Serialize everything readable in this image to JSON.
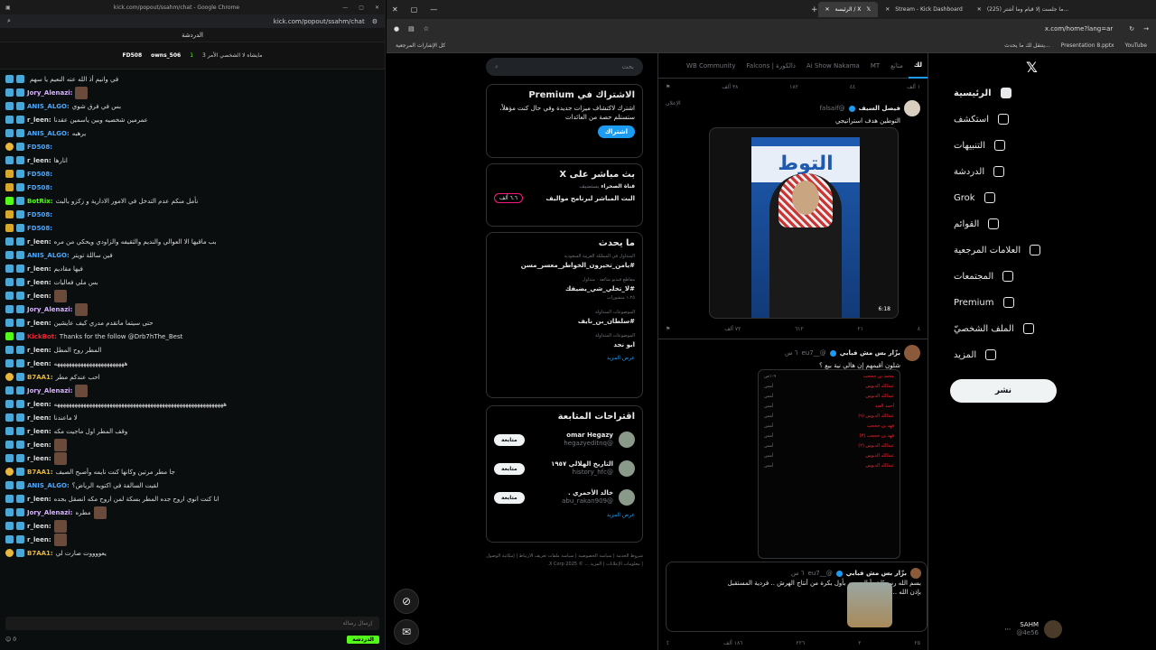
{
  "kick": {
    "title_bar": "kick.com/popout/ssahm/chat - Google Chrome",
    "url": "kick.com/popout/ssahm/chat",
    "header": "الدردشة",
    "pinned": {
      "user1": "FD508",
      "user2": "owns_506",
      "count": "1",
      "note": "مايشاه لا الشخصي الأمر 3"
    },
    "messages": [
      {
        "user": "",
        "text": "في وانيم أذ الله عنه النعيم يا سهم",
        "color": "#ddd",
        "badge": "blue"
      },
      {
        "user": "Jory_Alenazi:",
        "text": "",
        "color": "#d8b4ff",
        "badge": "blue",
        "img": true
      },
      {
        "user": "ANIS_ALGO:",
        "text": "بس في فرق شوي",
        "color": "#4aa8ff",
        "badge": "blue"
      },
      {
        "user": "r_leen:",
        "text": "عمرمين شخصيه وبين ياسمين عقدنا",
        "color": "#ddd",
        "badge": "blue"
      },
      {
        "user": "ANIS_ALGO:",
        "text": "يرهبه",
        "color": "#4aa8ff",
        "badge": "blue"
      },
      {
        "user": "FD508:",
        "text": "",
        "color": "#4aa8ff",
        "badge": "gold"
      },
      {
        "user": "r_leen:",
        "text": "انارها",
        "color": "#ddd",
        "badge": "blue"
      },
      {
        "user": "FD508:",
        "text": "",
        "color": "#4aa8ff",
        "badge": "crown"
      },
      {
        "user": "FD508:",
        "text": "",
        "color": "#4aa8ff",
        "badge": "crown"
      },
      {
        "user": "BotRix:",
        "text": "نأمل منكم عدم التدخل في الامور الادارية و زكزو بالبث",
        "color": "#53fc18",
        "badge": "green"
      },
      {
        "user": "FD508:",
        "text": "",
        "color": "#4aa8ff",
        "badge": "crown"
      },
      {
        "user": "FD508:",
        "text": "",
        "color": "#4aa8ff",
        "badge": "crown"
      },
      {
        "user": "r_leen:",
        "text": "بب ماقيها الا العوالي والنديم والثقيفه والزاودي ويحكي من مره",
        "color": "#ddd",
        "badge": "blue"
      },
      {
        "user": "ANIS_ALGO:",
        "text": "فين ساللة تويتر",
        "color": "#4aa8ff",
        "badge": "blue"
      },
      {
        "user": "r_leen:",
        "text": "فيها مقاديم",
        "color": "#ddd",
        "badge": "blue"
      },
      {
        "user": "r_leen:",
        "text": "بس ملي فعاليات",
        "color": "#ddd",
        "badge": "blue"
      },
      {
        "user": "r_leen:",
        "text": "",
        "color": "#ddd",
        "badge": "blue",
        "img": true
      },
      {
        "user": "Jory_Alenazi:",
        "text": "",
        "color": "#d8b4ff",
        "badge": "blue",
        "img": true
      },
      {
        "user": "r_leen:",
        "text": "حتى سيتما ماتقدم مدري كيف عايشين",
        "color": "#ddd",
        "badge": "blue"
      },
      {
        "user": "KickBot:",
        "text": "Thanks for the follow @Drb7hThe_Best",
        "color": "#f4212e",
        "badge": "green"
      },
      {
        "user": "r_leen:",
        "text": "المطر روح المطل",
        "color": "#ddd",
        "badge": "blue"
      },
      {
        "user": "r_leen:",
        "text": "ههههههههههههههههههههههههه",
        "color": "#ddd",
        "badge": "blue"
      },
      {
        "user": "B7AA1:",
        "text": "احب عندكم مطر",
        "color": "#e8b83a",
        "badge": "gold"
      },
      {
        "user": "Jory_Alenazi:",
        "text": "",
        "color": "#d8b4ff",
        "badge": "blue",
        "img": true
      },
      {
        "user": "r_leen:",
        "text": "ههههههههههههههههههههههههههههههههههههههههههههههههههههههههههه",
        "color": "#ddd",
        "badge": "blue"
      },
      {
        "user": "r_leen:",
        "text": "لا ماعندنا",
        "color": "#ddd",
        "badge": "blue"
      },
      {
        "user": "r_leen:",
        "text": "وقف المطر اول ماجيت مكه",
        "color": "#ddd",
        "badge": "blue"
      },
      {
        "user": "r_leen:",
        "text": "",
        "color": "#ddd",
        "badge": "blue",
        "img": true
      },
      {
        "user": "r_leen:",
        "text": "",
        "color": "#ddd",
        "badge": "blue",
        "img": true
      },
      {
        "user": "B7AA1:",
        "text": "جا مطر مرتين وكانها كنت نايمه وأصبح الصيف",
        "color": "#e8b83a",
        "badge": "gold"
      },
      {
        "user": "ANIS_ALGO:",
        "text": "لقيت السالفة في اكتوبه الرياض؟",
        "color": "#4aa8ff",
        "badge": "blue"
      },
      {
        "user": "r_leen:",
        "text": "انا كنت انوي اروح جده المطر بسكة لمن اروح مكه انصقل بجده",
        "color": "#ddd",
        "badge": "blue"
      },
      {
        "user": "Jory_Alenazi:",
        "text": "مطره",
        "color": "#d8b4ff",
        "badge": "blue",
        "img": true
      },
      {
        "user": "r_leen:",
        "text": "",
        "color": "#ddd",
        "badge": "blue",
        "img": true
      },
      {
        "user": "r_leen:",
        "text": "",
        "color": "#ddd",
        "badge": "blue",
        "img": true
      },
      {
        "user": "B7AA1:",
        "text": "يعووووت صارت لي",
        "color": "#e8b83a",
        "badge": "gold"
      }
    ],
    "input_placeholder": "إرسال رسالة",
    "send_label": "الدردشة",
    "counts": "0"
  },
  "chrome": {
    "tabs": [
      {
        "label": "(225) ما جلست إلا قيام وما أشتر...",
        "active": false
      },
      {
        "label": "Stream - Kick Dashboard",
        "active": false
      },
      {
        "label": "الرئيسة / X",
        "active": true
      }
    ],
    "url": "x.com/home?lang=ar",
    "bookmarks": [
      "YouTube",
      "Presentation 8.pptx",
      "يتنقل لك ما يحدث...",
      "كل الإشارات المرجعية"
    ]
  },
  "x": {
    "nav": [
      {
        "label": "الرئيسية",
        "active": true
      },
      {
        "label": "استكشف"
      },
      {
        "label": "التنبيهات"
      },
      {
        "label": "الدردشة"
      },
      {
        "label": "Grok"
      },
      {
        "label": "القوائم"
      },
      {
        "label": "العلامات المرجعية"
      },
      {
        "label": "المجتمعات"
      },
      {
        "label": "Premium"
      },
      {
        "label": "الملف الشخصيّ"
      },
      {
        "label": "المزيد"
      }
    ],
    "post_button": "نشر",
    "account": {
      "name": "SAHM",
      "handle": "@4e56"
    },
    "timeline_tabs": [
      "لك",
      "متابَع",
      "MT",
      "Ai Show Nakama",
      "ذالكورة | Falcons",
      "WB Community"
    ],
    "tweet1": {
      "name": "فيصل السيف",
      "handle": "@falsaif",
      "text": "التوطين هدف استراتيجي",
      "ad": "الإعلان",
      "video_banner": "التوط",
      "duration": "6:18",
      "actions_top": [
        "١ ألف",
        "٤٤",
        "١٨٢",
        "٣٨ ألف"
      ],
      "actions": [
        "٨",
        "٢١",
        "٦١٢",
        "٧٢ ألف"
      ]
    },
    "tweet2": {
      "name": "بزّار بس مش فبابي",
      "handle": "@__eu7",
      "time": "٦ س",
      "text": "شلون أقيمهم إن هالي نية بيع ؟",
      "list": [
        {
          "n": "محمد بن جحجب",
          "t": "٩-١ص"
        },
        {
          "n": "عبدالله الدبوس",
          "t": "أمس"
        },
        {
          "n": "عبدالله الدبوس",
          "t": "أمس"
        },
        {
          "n": "أحمد العيد",
          "t": "أمس"
        },
        {
          "n": "عبدالله الدبوس (٩)",
          "t": "أمس"
        },
        {
          "n": "فهد بن جحجب",
          "t": "أمس"
        },
        {
          "n": "فهد بن جحجب (٣)",
          "t": "أمس"
        },
        {
          "n": "عبدالله الدبوس (٢)",
          "t": "أمس"
        },
        {
          "n": "عبدالله الدبوس",
          "t": "أمس"
        },
        {
          "n": "عبدالله الدبوس",
          "t": "أمس"
        }
      ]
    },
    "tweet3": {
      "name": "بزّار بس مش فبابي",
      "handle": "@__eu7",
      "time": "٦ س",
      "text": "بسم الله رسميًا تبدأ الموسم بأول بكرة من أنتاج الهرش .. فردية المستقبل بإذن الله ..",
      "actions": [
        "٢٥",
        "٢",
        "٢٢٦",
        "١٨٦ ألف"
      ]
    },
    "sidebar": {
      "search_placeholder": "بحث",
      "premium": {
        "title": "الاشتراك في Premium",
        "text": "اشترك لاكتشاف ميزات جديدة وفي حال كنت مؤهلاً، ستستلم حصة من العائدات",
        "button": "اشتراك"
      },
      "live": {
        "title": "بث مباشر على X",
        "host": "قناة الصحراء",
        "host_note": "يستضيف",
        "subtitle": "البث المباشر لبرنامج مواليف",
        "count": "٦.٦ ألف"
      },
      "trends_title": "ما يحدث",
      "trends": [
        {
          "meta": "المتداول في المملكة العربية السعودية",
          "name": "#يامن_تحيرون_الخواطر_معسر_مسن"
        },
        {
          "meta": "مقاطع فيديو شائعة · متداول",
          "name": "#لا_تخلي_شي_يضيفك",
          "count": "١.٢٥ منشورات"
        },
        {
          "meta": "الموضوعات المتداولة",
          "name": "#سلطان_بن_نايف"
        },
        {
          "meta": "الموضوعات المتداولة",
          "name": "ابو نجد"
        }
      ],
      "show_more": "عرض المزيد",
      "follow_title": "اقتراحات المتابعة",
      "follows": [
        {
          "name": "omar Hegazy",
          "handle": "@hegazyeditnq",
          "button": "متابعة"
        },
        {
          "name": "التاريخ الهلالي ١٩٥٧",
          "handle": "@history_hfc",
          "button": "متابعة"
        },
        {
          "name": "خالد الأحمري .",
          "handle": "@abu_rakan909",
          "button": "متابعة"
        }
      ],
      "follow_more": "عرض المزيد",
      "footer": "شروط الخدمة | سياسة الخصوصية | سياسة ملفات تعريف الارتباط | إمكانية الوصول | معلومات الإعلانات | المزيد ... © 2025 X Corp."
    }
  }
}
